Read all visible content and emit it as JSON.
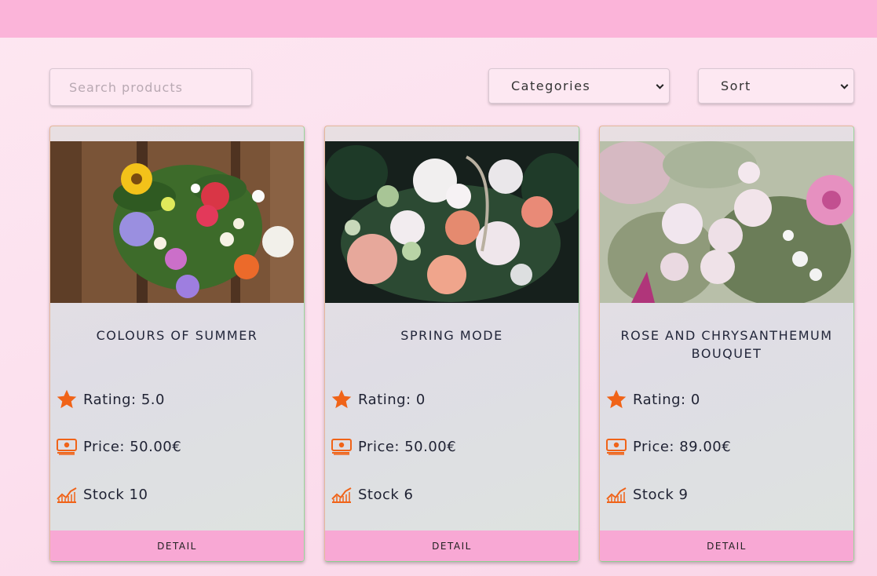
{
  "search": {
    "placeholder": "Search products"
  },
  "filters": {
    "categories_label": "Categories",
    "sort_label": "Sort"
  },
  "accent_color": "#f06318",
  "header_color": "#fbb4d9",
  "products": [
    {
      "title": "Colours of Summer",
      "rating_label": "Rating: 5.0",
      "price_label": "Price: 50.00€",
      "stock_label": "Stock 10",
      "detail_label": "Detail",
      "image_icon": "summer-bouquet-photo"
    },
    {
      "title": "Spring Mode",
      "rating_label": "Rating: 0",
      "price_label": "Price: 50.00€",
      "stock_label": "Stock 6",
      "detail_label": "Detail",
      "image_icon": "spring-bouquet-photo"
    },
    {
      "title": "Rose and Chrysanthemum Bouquet",
      "rating_label": "Rating: 0",
      "price_label": "Price: 89.00€",
      "stock_label": "Stock 9",
      "detail_label": "Detail",
      "image_icon": "rose-bouquet-photo"
    }
  ]
}
